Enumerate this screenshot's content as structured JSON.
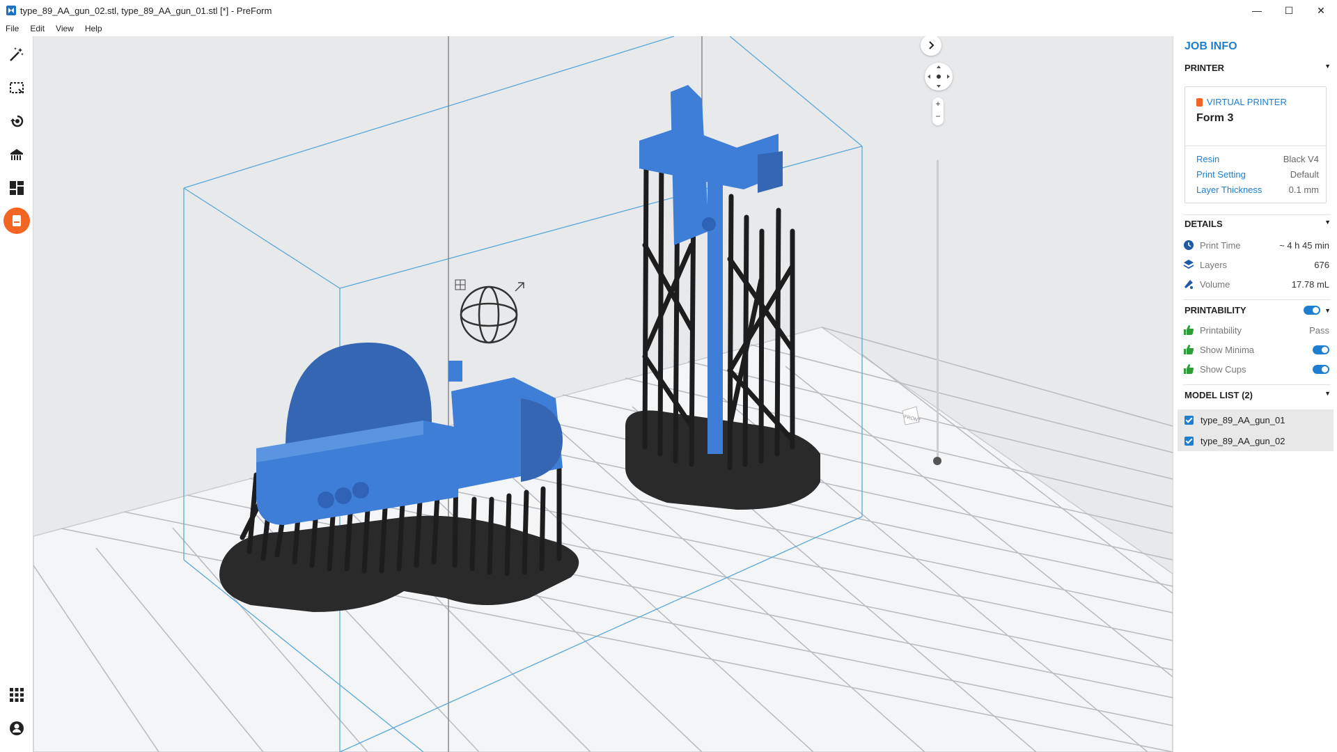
{
  "window": {
    "title": "type_89_AA_gun_02.stl, type_89_AA_gun_01.stl [*] - PreForm",
    "controls": {
      "minimize": "—",
      "maximize": "☐",
      "close": "✕"
    }
  },
  "menu": [
    "File",
    "Edit",
    "View",
    "Help"
  ],
  "toolbar": {
    "tools": [
      "magic-wand",
      "select-box",
      "orientation",
      "supports",
      "layout",
      "job-info"
    ],
    "bottom": [
      "apps-grid",
      "account"
    ]
  },
  "viewport": {
    "corner_label": "FRONT"
  },
  "panel": {
    "title": "JOB INFO",
    "printer_section": "PRINTER",
    "printer_type": "VIRTUAL PRINTER",
    "printer_name": "Form 3",
    "resin_label": "Resin",
    "resin_value": "Black V4",
    "setting_label": "Print Setting",
    "setting_value": "Default",
    "layer_label": "Layer Thickness",
    "layer_value": "0.1 mm",
    "details_section": "DETAILS",
    "print_time_label": "Print Time",
    "print_time_value": "~ 4 h 45 min",
    "layers_label": "Layers",
    "layers_value": "676",
    "volume_label": "Volume",
    "volume_value": "17.78 mL",
    "printability_section": "PRINTABILITY",
    "printability_label": "Printability",
    "printability_value": "Pass",
    "minima_label": "Show Minima",
    "cups_label": "Show Cups",
    "model_list_section": "MODEL LIST (2)",
    "models": [
      "type_89_AA_gun_01",
      "type_89_AA_gun_02"
    ]
  },
  "colors": {
    "accent": "#1e7fd0",
    "active_tool": "#f26522",
    "model_blue": "#3f7ed6",
    "support_black": "#2a2a2a",
    "thumbs_green": "#2e9e3b"
  }
}
